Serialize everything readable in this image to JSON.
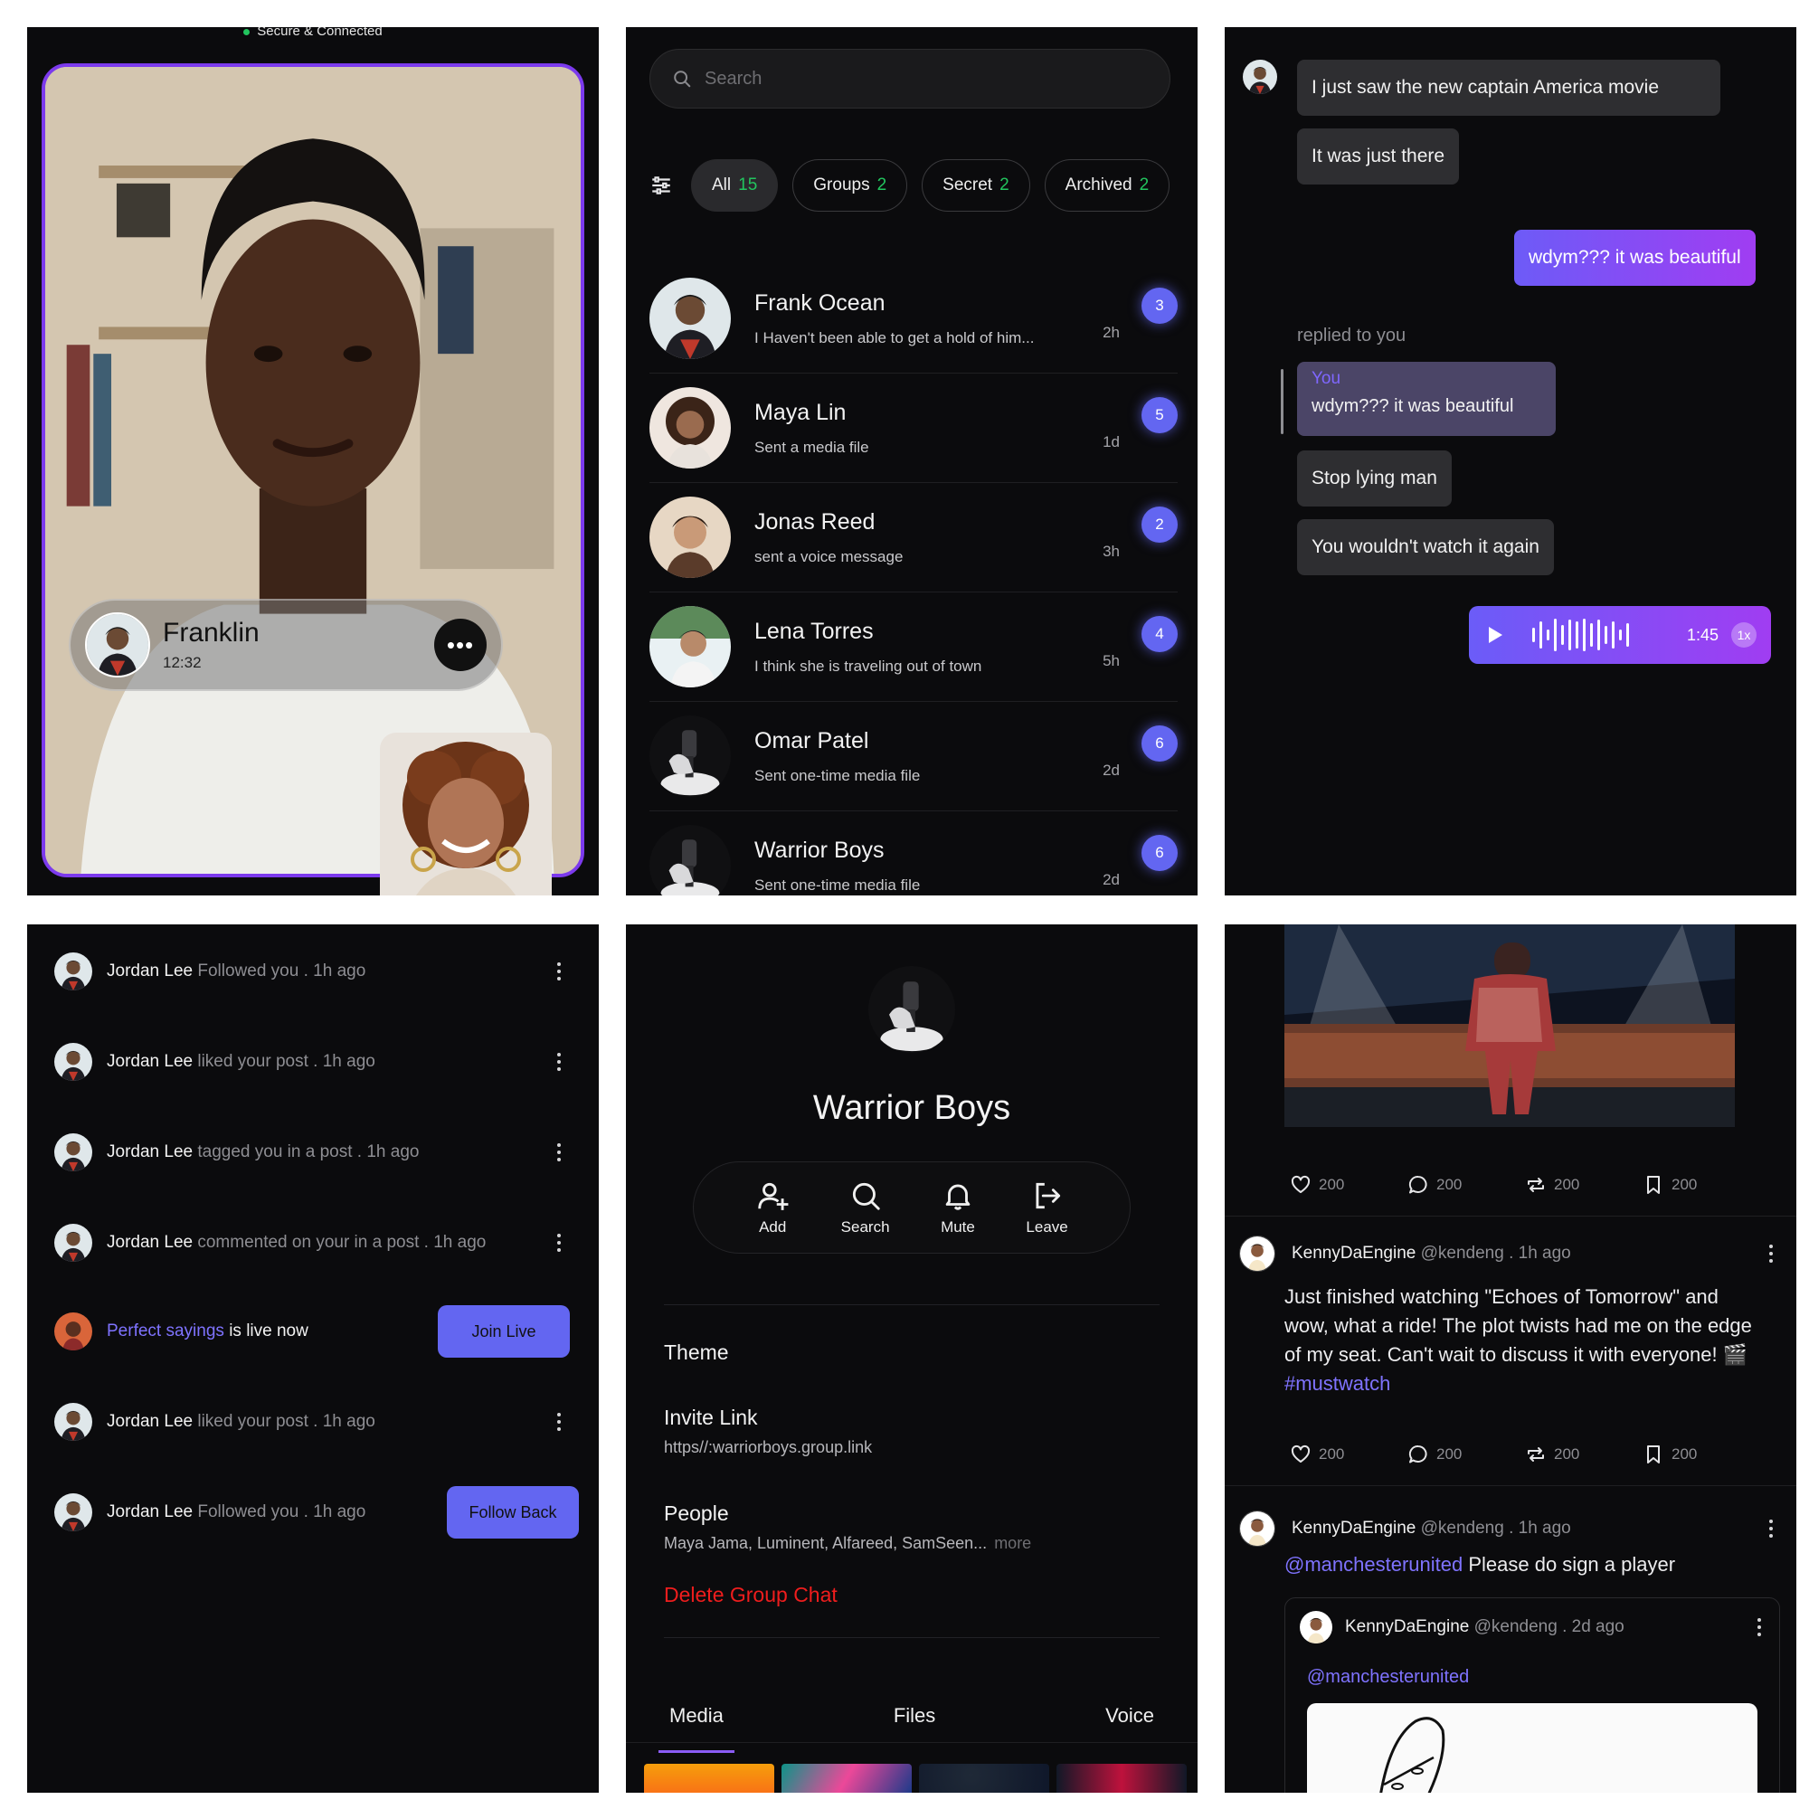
{
  "video_call": {
    "status": "Secure & Connected",
    "caller_name": "Franklin",
    "call_time": "12:32"
  },
  "chat_list": {
    "search_placeholder": "Search",
    "filters": [
      {
        "label": "All",
        "count": "15"
      },
      {
        "label": "Groups",
        "count": "2"
      },
      {
        "label": "Secret",
        "count": "2"
      },
      {
        "label": "Archived",
        "count": "2"
      }
    ],
    "chats": [
      {
        "name": "Frank Ocean",
        "message": "I Haven't been able to get a hold of him...",
        "time": "2h",
        "unread": "3"
      },
      {
        "name": "Maya Lin",
        "message": "Sent a media file",
        "time": "1d",
        "unread": "5"
      },
      {
        "name": "Jonas Reed",
        "message": "sent a voice message",
        "time": "3h",
        "unread": "2"
      },
      {
        "name": "Lena Torres",
        "message": "I think she is traveling out of town",
        "time": "5h",
        "unread": "4"
      },
      {
        "name": "Omar Patel",
        "message": "Sent one-time media file",
        "time": "2d",
        "unread": "6"
      },
      {
        "name": "Warrior Boys",
        "message": "Sent one-time media file",
        "time": "2d",
        "unread": "6"
      }
    ]
  },
  "conversation": {
    "msg1": "I just saw the new captain America movie",
    "msg2": "It was just there",
    "msg3": "wdym??? it was beautiful",
    "replied_label": "replied to you",
    "reply_author": "You",
    "reply_quote": "wdym??? it was beautiful",
    "msg4": "Stop lying man",
    "msg5": "You wouldn't watch it again",
    "voice_duration": "1:45",
    "voice_speed": "1x"
  },
  "notifications": [
    {
      "name": "Jordan Lee",
      "action": "Followed you",
      "time": ". 1h ago"
    },
    {
      "name": "Jordan Lee",
      "action": "liked your post",
      "time": ". 1h ago"
    },
    {
      "name": "Jordan Lee",
      "action": "tagged you in a post",
      "time": ". 1h ago"
    },
    {
      "name": "Jordan Lee",
      "action": "commented on your in a post",
      "time": ". 1h ago"
    },
    {
      "name": "Perfect sayings",
      "action": "is live now",
      "button": "Join Live"
    },
    {
      "name": "Jordan Lee",
      "action": "liked your post",
      "time": ". 1h ago"
    },
    {
      "name": "Jordan Lee",
      "action": "Followed you",
      "time": ". 1h ago",
      "button": "Follow Back"
    }
  ],
  "group_info": {
    "name": "Warrior Boys",
    "actions": [
      "Add",
      "Search",
      "Mute",
      "Leave"
    ],
    "theme_label": "Theme",
    "invite_label": "Invite Link",
    "invite_url": "https//:warriorboys.group.link",
    "people_label": "People",
    "people_list": "Maya Jama, Luminent, Alfareed, SamSeen...",
    "people_more": "more",
    "delete_label": "Delete Group Chat",
    "tabs": [
      "Media",
      "Files",
      "Voice"
    ]
  },
  "feed": {
    "post1_stats": [
      "200",
      "200",
      "200",
      "200"
    ],
    "post2": {
      "user": "KennyDaEngine",
      "handle": "@kendeng . 1h ago",
      "text": "Just finished watching \"Echoes of Tomorrow\" and wow, what a ride! The plot twists had me on the edge of my seat. Can't wait to discuss it with everyone! 🎬",
      "hashtag": "#mustwatch",
      "stats": [
        "200",
        "200",
        "200",
        "200"
      ]
    },
    "post3": {
      "user": "KennyDaEngine",
      "handle": "@kendeng . 1h ago",
      "mention": "@manchesterunited",
      "text": "Please do sign a player",
      "quoted_user": "KennyDaEngine",
      "quoted_handle": "@kendeng . 2d ago",
      "quoted_mention": "@manchesterunited"
    }
  },
  "colors": {
    "accent": "#6366f1",
    "accent_gradient_end": "#a03df2",
    "online": "#22c55e",
    "danger": "#ef1d1d",
    "background": "#0b0b0d"
  }
}
